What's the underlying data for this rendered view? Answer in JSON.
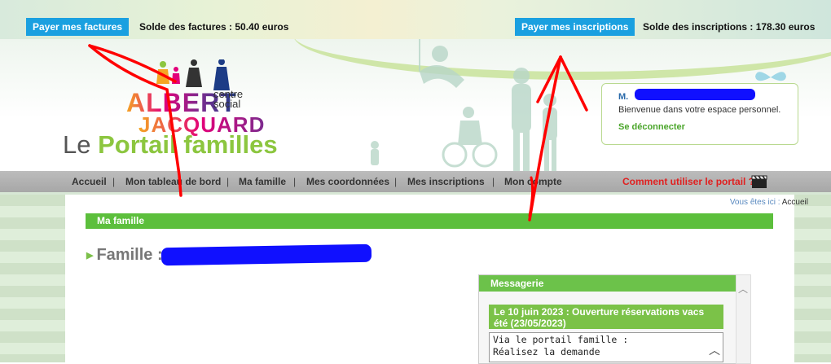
{
  "topbar": {
    "pay_invoices_label": "Payer mes factures",
    "invoices_balance": "Solde des factures : 50.40 euros",
    "pay_registrations_label": "Payer mes inscriptions",
    "registrations_balance": "Solde des inscriptions : 178.30 euros"
  },
  "logo": {
    "line1": "ALBERT",
    "line2": "JACQUARD",
    "tag_line1": "centre",
    "tag_line2": "social",
    "portal_prefix": "Le ",
    "portal_name": "Portail familles"
  },
  "user": {
    "name": "M.",
    "welcome": "Bienvenue dans votre espace personnel.",
    "logout": "Se déconnecter"
  },
  "nav": {
    "items": [
      "Accueil",
      "Mon tableau de bord",
      "Ma famille",
      "Mes coordonnées",
      "Mes inscriptions",
      "Mon compte"
    ],
    "separator": "|",
    "help": "Comment utiliser le portail ?"
  },
  "breadcrumb": {
    "prefix": "Vous êtes ici :",
    "current": "Accueil"
  },
  "page": {
    "section_title": "Ma famille",
    "family_label": "Famille :"
  },
  "messagerie": {
    "title": "Messagerie",
    "item_title": "Le 10 juin 2023 : Ouverture réservations vacs été (23/05/2023)",
    "item_text": "Via le portail famille :\nRéalisez la demande"
  },
  "colors": {
    "accent_blue": "#1aa0e0",
    "accent_green": "#5cbf3c",
    "help_red": "#e02020",
    "annotation_red": "#ff0000",
    "redaction_blue": "#1010ff"
  }
}
